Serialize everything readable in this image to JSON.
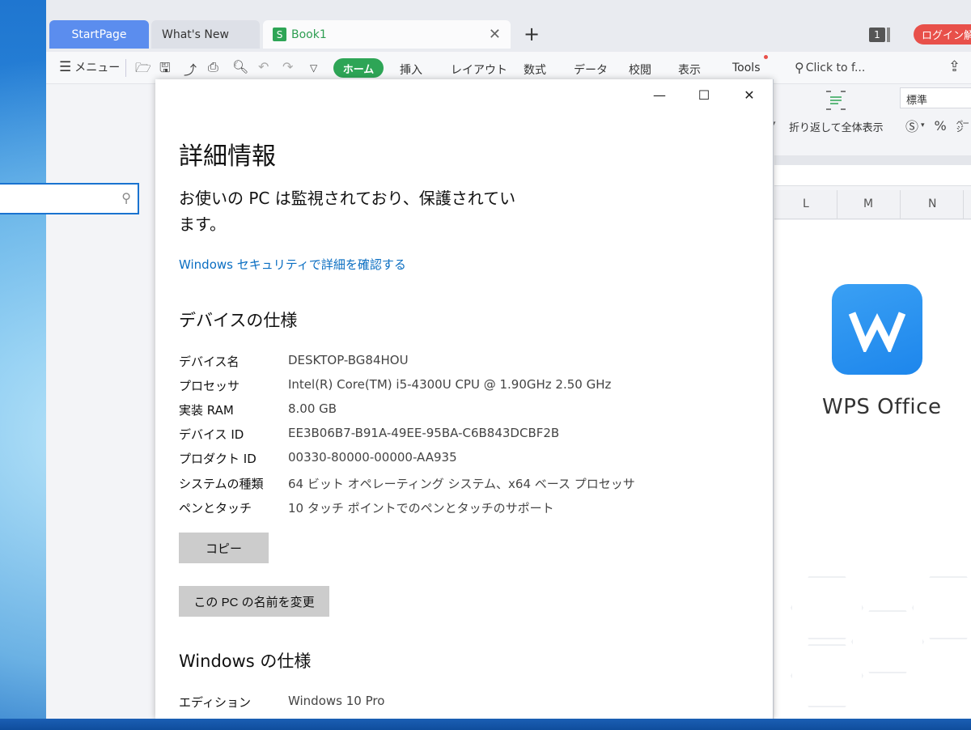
{
  "wps": {
    "tabs": [
      {
        "label": "StartPage"
      },
      {
        "label": "What's New"
      },
      {
        "label": "Book1",
        "icon": "S"
      }
    ],
    "tab_count": "1",
    "login_label": "ログイン解",
    "menu_label": "メニュー",
    "home_tab": "ホーム",
    "ribbon_tabs": [
      "挿入",
      "レイアウト",
      "数式",
      "データ",
      "校閲",
      "表示",
      "Tools"
    ],
    "search_placeholder": "Click to f...",
    "wrap_label": "折り返して全体表示",
    "number_format": "標準",
    "columns": [
      "L",
      "M",
      "N"
    ],
    "logo_text": "WPS Office",
    "brand_color": "#1d86ec",
    "accent_green": "#2ea556"
  },
  "about": {
    "title": "詳細情報",
    "protection_status": "お使いの PC は監視されており、保護されています。",
    "security_link": "Windows セキュリティで詳細を確認する",
    "device_section": "デバイスの仕様",
    "device_specs": [
      {
        "label": "デバイス名",
        "value": "DESKTOP-BG84HOU"
      },
      {
        "label": "プロセッサ",
        "value": "Intel(R) Core(TM) i5-4300U CPU @ 1.90GHz   2.50 GHz"
      },
      {
        "label": "実装 RAM",
        "value": "8.00 GB"
      },
      {
        "label": "デバイス ID",
        "value": "EE3B06B7-B91A-49EE-95BA-C6B843DCBF2B"
      },
      {
        "label": "プロダクト ID",
        "value": "00330-80000-00000-AA935"
      },
      {
        "label": "システムの種類",
        "value": "64 ビット オペレーティング システム、x64 ベース プロセッサ"
      },
      {
        "label": "ペンとタッチ",
        "value": "10 タッチ ポイントでのペンとタッチのサポート"
      }
    ],
    "copy_button": "コピー",
    "rename_button": "この PC の名前を変更",
    "windows_section": "Windows の仕様",
    "windows_specs": [
      {
        "label": "エディション",
        "value": "Windows 10 Pro"
      }
    ],
    "link_color": "#0a6ec2"
  }
}
